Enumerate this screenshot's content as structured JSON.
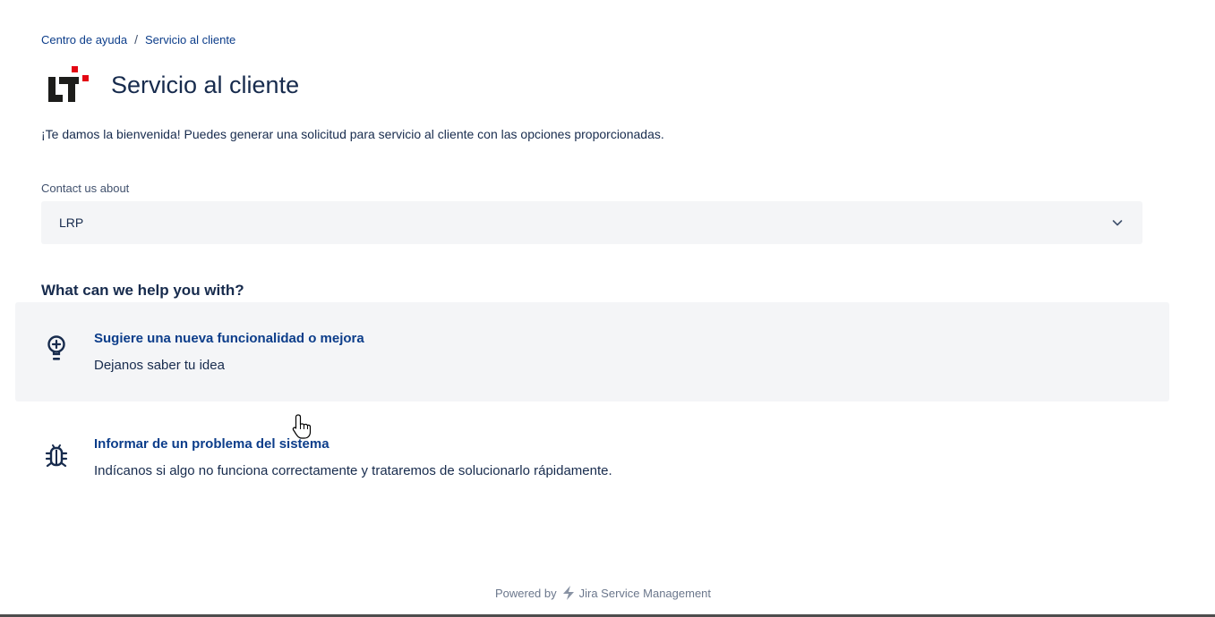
{
  "breadcrumb": {
    "items": [
      "Centro de ayuda",
      "Servicio al cliente"
    ],
    "separator": "/"
  },
  "header": {
    "title": "Servicio al cliente",
    "logo_colors": {
      "dark": "#1d1d1b",
      "accent": "#e30613"
    }
  },
  "welcome_text": "¡Te damos la bienvenida! Puedes generar una solicitud para servicio al cliente con las opciones proporcionadas.",
  "contact": {
    "label": "Contact us about",
    "selected": "LRP"
  },
  "help": {
    "heading": "What can we help you with?",
    "options": [
      {
        "icon": "lightbulb-icon",
        "title": "Sugiere una nueva funcionalidad o mejora",
        "description": "Dejanos saber tu idea"
      },
      {
        "icon": "bug-icon",
        "title": "Informar de un problema del sistema",
        "description": "Indícanos si algo no funciona correctamente y trataremos de solucionarlo rápidamente."
      }
    ]
  },
  "footer": {
    "powered_by": "Powered by",
    "product": "Jira Service Management"
  },
  "colors": {
    "link": "#0c3d8a",
    "text": "#172b4d",
    "muted": "#42526e",
    "select_bg": "#f4f5f7"
  }
}
